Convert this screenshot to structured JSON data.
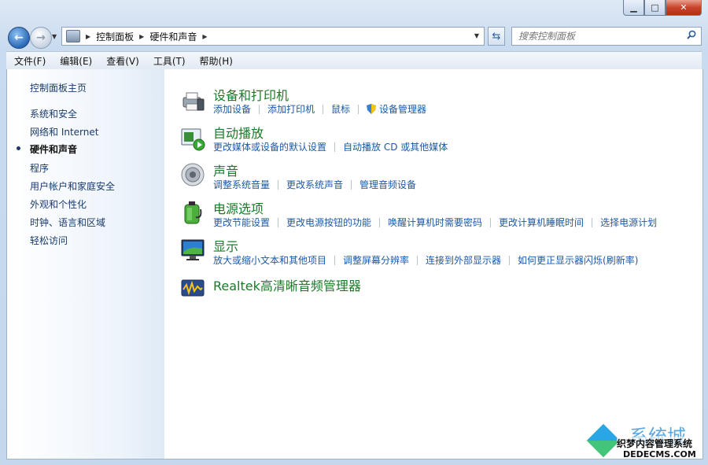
{
  "window": {
    "caption_buttons": {
      "minimize": "▁",
      "maximize": "□",
      "close": "✕"
    }
  },
  "address": {
    "breadcrumbs": [
      "控制面板",
      "硬件和声音"
    ],
    "search_placeholder": "搜索控制面板"
  },
  "menu": [
    "文件(F)",
    "编辑(E)",
    "查看(V)",
    "工具(T)",
    "帮助(H)"
  ],
  "sidebar": {
    "items": [
      {
        "label": "控制面板主页",
        "active": false
      },
      {
        "label": "系统和安全",
        "active": false
      },
      {
        "label": "网络和 Internet",
        "active": false
      },
      {
        "label": "硬件和声音",
        "active": true
      },
      {
        "label": "程序",
        "active": false
      },
      {
        "label": "用户帐户和家庭安全",
        "active": false
      },
      {
        "label": "外观和个性化",
        "active": false
      },
      {
        "label": "时钟、语言和区域",
        "active": false
      },
      {
        "label": "轻松访问",
        "active": false
      }
    ]
  },
  "categories": [
    {
      "title": "设备和打印机",
      "icon": "printer-icon",
      "links": [
        "添加设备",
        "添加打印机",
        "鼠标",
        "设备管理器"
      ]
    },
    {
      "title": "自动播放",
      "icon": "autoplay-icon",
      "links": [
        "更改媒体或设备的默认设置",
        "自动播放 CD 或其他媒体"
      ]
    },
    {
      "title": "声音",
      "icon": "speaker-icon",
      "links": [
        "调整系统音量",
        "更改系统声音",
        "管理音频设备"
      ]
    },
    {
      "title": "电源选项",
      "icon": "battery-icon",
      "links": [
        "更改节能设置",
        "更改电源按钮的功能",
        "唤醒计算机时需要密码",
        "更改计算机睡眠时间",
        "选择电源计划"
      ]
    },
    {
      "title": "显示",
      "icon": "monitor-icon",
      "links": [
        "放大或缩小文本和其他项目",
        "调整屏幕分辨率",
        "连接到外部显示器",
        "如何更正显示器闪烁(刷新率)"
      ]
    },
    {
      "title": "Realtek高清晰音频管理器",
      "icon": "realtek-audio-icon",
      "links": []
    }
  ],
  "watermark": {
    "big": "系统城",
    "line1": "织梦内容管理系统",
    "line2": "DEDECMS.COM"
  },
  "colors": {
    "category_title": "#1a7a27",
    "link": "#1a5aa8",
    "sidebar_text": "#1a3a6b"
  }
}
